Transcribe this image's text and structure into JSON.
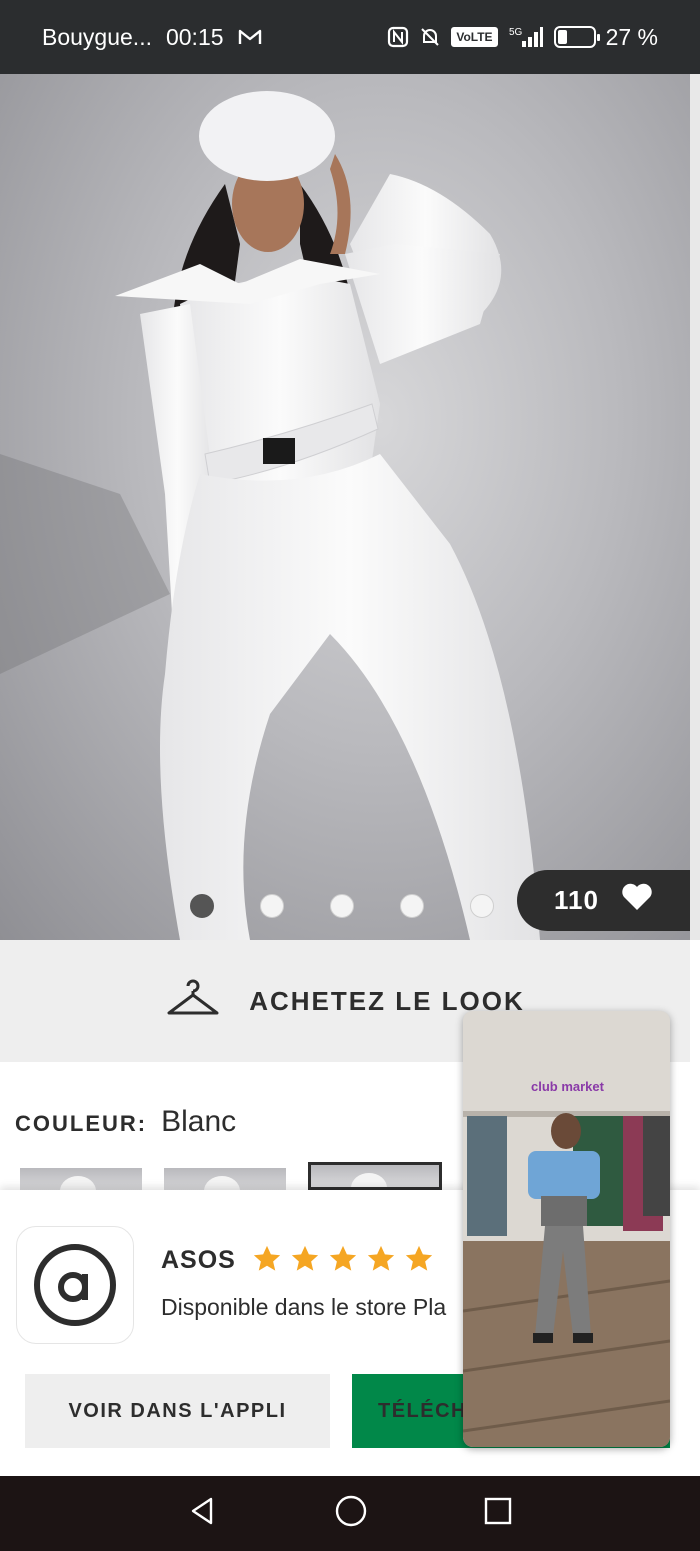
{
  "status_bar": {
    "carrier": "Bouygue...",
    "time": "00:15",
    "network": "5G",
    "volte": "VoLTE",
    "battery": "27 %",
    "battery_level": 0.27
  },
  "product": {
    "likes": "110",
    "carousel_total": 5,
    "carousel_active": 1,
    "shop_the_look": "ACHETEZ LE LOOK",
    "colour_label": "COULEUR:",
    "colour_value": "Blanc"
  },
  "app_banner": {
    "app_name": "ASOS",
    "rating": 5,
    "subtitle": "Disponible dans le store Pla",
    "open_button": "VOIR DANS L'APPLI",
    "download_button": "TÉLÉCH..."
  },
  "pip_video": {
    "store_sign": "club market"
  },
  "icons": [
    "hanger-icon",
    "heart-icon",
    "star-icon",
    "asos-logo-icon",
    "back-icon",
    "home-icon",
    "recents-icon",
    "mail-icon",
    "nfc-icon",
    "mute-icon",
    "signal-icon",
    "battery-icon"
  ],
  "colors": {
    "status_bar_bg": "#2b2d2f",
    "dark": "#2d2d2d",
    "light_gray": "#eeeeee",
    "green": "#018849",
    "star": "#f5a623",
    "nav_bg": "#1c1414"
  }
}
